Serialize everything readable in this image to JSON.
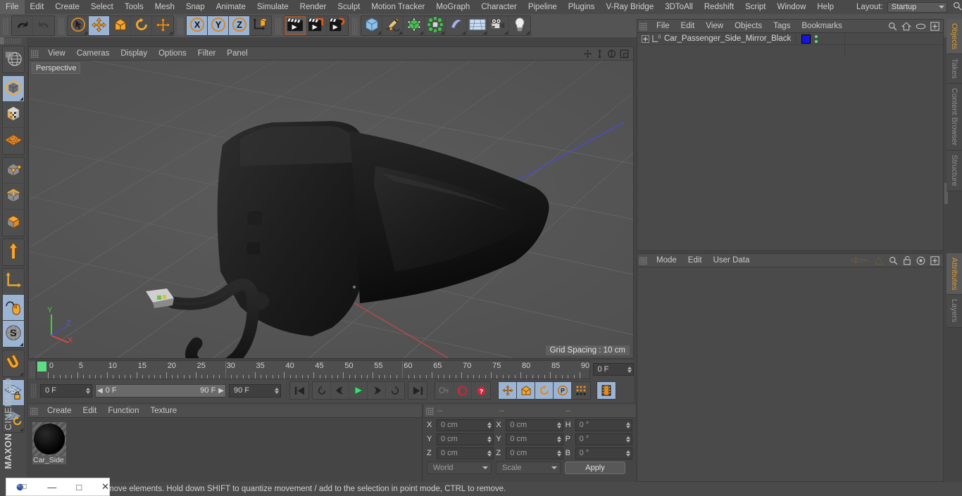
{
  "app": {
    "name": "CINEMA 4D",
    "vendor": "MAXON"
  },
  "menubar": {
    "items": [
      "File",
      "Edit",
      "Create",
      "Select",
      "Tools",
      "Mesh",
      "Snap",
      "Animate",
      "Simulate",
      "Render",
      "Sculpt",
      "Motion Tracker",
      "MoGraph",
      "Character",
      "Pipeline",
      "Plugins",
      "V-Ray Bridge",
      "3DToAll",
      "Redshift",
      "Script",
      "Window",
      "Help"
    ],
    "layout_label": "Layout:",
    "layout_value": "Startup",
    "search_icon": "search-icon"
  },
  "toolbar": {
    "groups": [
      {
        "name": "undo-redo",
        "buttons": [
          {
            "name": "undo-button",
            "icon": "undo-arrow-icon",
            "state": "normal"
          },
          {
            "name": "redo-button",
            "icon": "redo-arrow-icon",
            "state": "disabled"
          }
        ]
      },
      {
        "name": "selection-tools",
        "buttons": [
          {
            "name": "live-selection-tool",
            "icon": "cursor-circle-icon",
            "state": "corner"
          },
          {
            "name": "move-tool",
            "icon": "move-arrows-icon",
            "state": "selected"
          },
          {
            "name": "scale-tool",
            "icon": "scale-box-icon",
            "state": "normal"
          },
          {
            "name": "rotate-tool",
            "icon": "rotate-circle-icon",
            "state": "normal"
          },
          {
            "name": "free-move-tool",
            "icon": "move-arrows-icon",
            "state": "corner"
          }
        ]
      },
      {
        "name": "axis-locks",
        "buttons": [
          {
            "name": "x-axis-lock",
            "icon": "x-axis-icon",
            "state": "selected"
          },
          {
            "name": "y-axis-lock",
            "icon": "y-axis-icon",
            "state": "selected"
          },
          {
            "name": "z-axis-lock",
            "icon": "z-axis-icon",
            "state": "selected"
          },
          {
            "name": "world-object-coord-toggle",
            "icon": "world-axis-cube-icon",
            "state": "normal"
          }
        ]
      },
      {
        "name": "render-group",
        "buttons": [
          {
            "name": "render-view-button",
            "icon": "clapperboard-icon",
            "state": "highlight"
          },
          {
            "name": "render-to-picture-viewer-button",
            "icon": "clapperboard-render-icon",
            "state": "normal"
          },
          {
            "name": "render-settings-button",
            "icon": "clapperboard-gear-icon",
            "state": "normal"
          }
        ]
      },
      {
        "name": "create-objects",
        "buttons": [
          {
            "name": "add-cube-button",
            "icon": "blue-cube-icon",
            "state": "corner"
          },
          {
            "name": "add-spline-button",
            "icon": "pen-spline-icon",
            "state": "corner"
          },
          {
            "name": "add-generator-button",
            "icon": "green-cube-nurbs-icon",
            "state": "corner"
          },
          {
            "name": "add-mograph-button",
            "icon": "green-cluster-icon",
            "state": "corner"
          },
          {
            "name": "add-deformer-button",
            "icon": "bend-deformer-icon",
            "state": "corner"
          },
          {
            "name": "add-environment-button",
            "icon": "floor-grid-icon",
            "state": "corner"
          },
          {
            "name": "add-camera-button",
            "icon": "camera-icon",
            "state": "corner"
          },
          {
            "name": "add-light-button",
            "icon": "lightbulb-icon",
            "state": "corner"
          }
        ]
      }
    ]
  },
  "left_toolbar": {
    "groups": [
      {
        "name": "make-editable-group",
        "buttons": [
          {
            "name": "make-editable-button",
            "icon": "globe-wireframe-icon",
            "state": "normal"
          }
        ]
      },
      {
        "name": "mode-group-object",
        "buttons": [
          {
            "name": "model-mode-button",
            "icon": "model-cube-icon",
            "state": "selected-corner"
          },
          {
            "name": "texture-mode-button",
            "icon": "texture-checker-cube-icon",
            "state": "normal"
          },
          {
            "name": "workplane-mode-button",
            "icon": "workplane-grid-icon",
            "state": "normal"
          }
        ]
      },
      {
        "name": "component-modes",
        "buttons": [
          {
            "name": "points-mode-button",
            "icon": "points-cube-icon",
            "state": "normal"
          },
          {
            "name": "edges-mode-button",
            "icon": "edges-cube-icon",
            "state": "normal"
          },
          {
            "name": "polygons-mode-button",
            "icon": "polygons-cube-icon",
            "state": "normal"
          }
        ]
      },
      {
        "name": "axis-group",
        "buttons": [
          {
            "name": "enable-axis-button",
            "icon": "axis-up-arrow-icon",
            "state": "normal"
          }
        ]
      },
      {
        "name": "lock-group",
        "buttons": [
          {
            "name": "object-axis-button",
            "icon": "L-axis-icon",
            "state": "normal"
          },
          {
            "name": "viewport-solo-button",
            "icon": "mouse-spline-icon",
            "state": "selected"
          },
          {
            "name": "scale-snap-button",
            "icon": "s-sphere-icon",
            "state": "selected-corner"
          }
        ]
      },
      {
        "name": "magnet-group",
        "buttons": [
          {
            "name": "magnet-tool-button",
            "icon": "magnet-icon",
            "state": "corner"
          }
        ]
      },
      {
        "name": "workplane-group",
        "buttons": [
          {
            "name": "lock-workplane-button",
            "icon": "grid-lock-icon",
            "state": "selected"
          },
          {
            "name": "planar-workplane-button",
            "icon": "grid-rotate-icon",
            "state": "corner"
          }
        ]
      }
    ]
  },
  "viewport": {
    "menu": [
      "View",
      "Cameras",
      "Display",
      "Options",
      "Filter",
      "Panel"
    ],
    "label": "Perspective",
    "grid_spacing": "Grid Spacing : 10 cm",
    "axis_labels": {
      "x": "X",
      "y": "Y",
      "z": "Z"
    },
    "axis_colors": {
      "x": "#e04040",
      "y": "#40d040",
      "z": "#4040e8"
    },
    "corner_icons": [
      "pan-view-icon",
      "zoom-view-icon",
      "rotate-view-icon",
      "maximize-view-icon"
    ],
    "scene_object": "Car_Passenger_Side_Mirror_Black"
  },
  "timeline": {
    "ticks": [
      {
        "label": "0",
        "frame": 0
      },
      {
        "label": "5",
        "frame": 5
      },
      {
        "label": "10",
        "frame": 10
      },
      {
        "label": "15",
        "frame": 15
      },
      {
        "label": "20",
        "frame": 20
      },
      {
        "label": "25",
        "frame": 25
      },
      {
        "label": "30",
        "frame": 30
      },
      {
        "label": "35",
        "frame": 35
      },
      {
        "label": "40",
        "frame": 40
      },
      {
        "label": "45",
        "frame": 45
      },
      {
        "label": "50",
        "frame": 50
      },
      {
        "label": "55",
        "frame": 55
      },
      {
        "label": "60",
        "frame": 60
      },
      {
        "label": "65",
        "frame": 65
      },
      {
        "label": "70",
        "frame": 70
      },
      {
        "label": "75",
        "frame": 75
      },
      {
        "label": "80",
        "frame": 80
      },
      {
        "label": "85",
        "frame": 85
      },
      {
        "label": "90",
        "frame": 90
      }
    ],
    "range_min": 0,
    "range_max": 90,
    "current_frame_field": "0 F",
    "start_field": "0 F",
    "range_left": "0 F",
    "range_right": "90 F",
    "end_field": "90 F",
    "playback_buttons": [
      {
        "name": "go-to-start-button",
        "icon": "skip-start-icon",
        "state": "normal"
      },
      {
        "name": "go-back-keyframe-button",
        "icon": "rewind-key-icon",
        "state": "normal"
      },
      {
        "name": "step-back-button",
        "icon": "step-back-icon",
        "state": "normal"
      },
      {
        "name": "play-button",
        "icon": "play-triangle-icon",
        "state": "normal"
      },
      {
        "name": "step-forward-button",
        "icon": "step-forward-icon",
        "state": "normal"
      },
      {
        "name": "go-forward-keyframe-button",
        "icon": "forward-key-icon",
        "state": "normal"
      },
      {
        "name": "go-to-end-button",
        "icon": "skip-end-icon",
        "state": "normal"
      }
    ],
    "record_buttons": [
      {
        "name": "autokeying-button",
        "icon": "key-icon",
        "state": "disabled"
      },
      {
        "name": "record-active-objects-button",
        "icon": "record-red-icon",
        "state": "normal"
      },
      {
        "name": "keyframe-selection-button",
        "icon": "question-red-icon",
        "state": "normal"
      }
    ],
    "key_toggles": [
      {
        "name": "position-key-toggle",
        "icon": "move-arrows-icon",
        "state": "selected"
      },
      {
        "name": "scale-key-toggle",
        "icon": "scale-box-icon",
        "state": "selected"
      },
      {
        "name": "rotation-key-toggle",
        "icon": "rotate-circle-icon",
        "state": "selected"
      },
      {
        "name": "pla-key-toggle",
        "icon": "p-circle-icon",
        "state": "selected"
      },
      {
        "name": "param-key-toggle",
        "icon": "dot-grid-icon",
        "state": "normal"
      },
      {
        "name": "filmstrip-toggle",
        "icon": "filmstrip-icon",
        "state": "selected"
      }
    ]
  },
  "material_manager": {
    "menu": [
      "Create",
      "Edit",
      "Function",
      "Texture"
    ],
    "materials": [
      {
        "name": "Car_Side",
        "swatch": "#000000"
      }
    ]
  },
  "coordinates": {
    "headers": [
      "--",
      "--",
      "--"
    ],
    "rows": [
      {
        "pos_label": "X",
        "pos_value": "0 cm",
        "size_label": "X",
        "size_value": "0 cm",
        "rot_label": "H",
        "rot_value": "0 °"
      },
      {
        "pos_label": "Y",
        "pos_value": "0 cm",
        "size_label": "Y",
        "size_value": "0 cm",
        "rot_label": "P",
        "rot_value": "0 °"
      },
      {
        "pos_label": "Z",
        "pos_value": "0 cm",
        "size_label": "Z",
        "size_value": "0 cm",
        "rot_label": "B",
        "rot_value": "0 °"
      }
    ],
    "coord_system": "World",
    "transform_mode": "Scale",
    "apply_label": "Apply"
  },
  "object_manager": {
    "menu": [
      "File",
      "Edit",
      "View",
      "Objects",
      "Tags",
      "Bookmarks"
    ],
    "header_icons": [
      "search-icon",
      "home-icon",
      "eye-icon",
      "plus-icon"
    ],
    "objects": [
      {
        "name": "Car_Passenger_Side_Mirror_Black",
        "layer_badge": "0",
        "expandable": true,
        "material_color": "#1414e0"
      }
    ]
  },
  "attribute_manager": {
    "menu": [
      "Mode",
      "Edit",
      "User Data"
    ],
    "header_icons": [
      "back-nav-icon",
      "up-nav-icon",
      "search-icon",
      "lock-icon",
      "target-icon",
      "plus-icon"
    ]
  },
  "right_tabs_top": [
    {
      "label": "Objects",
      "active": true
    },
    {
      "label": "Takes",
      "active": false
    },
    {
      "label": "Content Browser",
      "active": false
    },
    {
      "label": "Structure",
      "active": false
    }
  ],
  "right_tabs_bottom": [
    {
      "label": "Attributes",
      "active": true
    },
    {
      "label": "Layers",
      "active": false
    }
  ],
  "statusbar": {
    "text": "move elements. Hold down SHIFT to quantize movement / add to the selection in point mode, CTRL to remove."
  },
  "window_overlay": {
    "icons": [
      "app-icon",
      "minimize-icon",
      "maximize-icon",
      "close-icon"
    ],
    "minimize": "—",
    "maximize": "□",
    "close": "✕"
  },
  "colors": {
    "accent_orange": "#d99b2e",
    "selected_blue": "#9bb4d4",
    "panel_bg": "#4a4a4a",
    "toolbar_bg": "#545454",
    "green_playhead": "#5fdd85"
  }
}
